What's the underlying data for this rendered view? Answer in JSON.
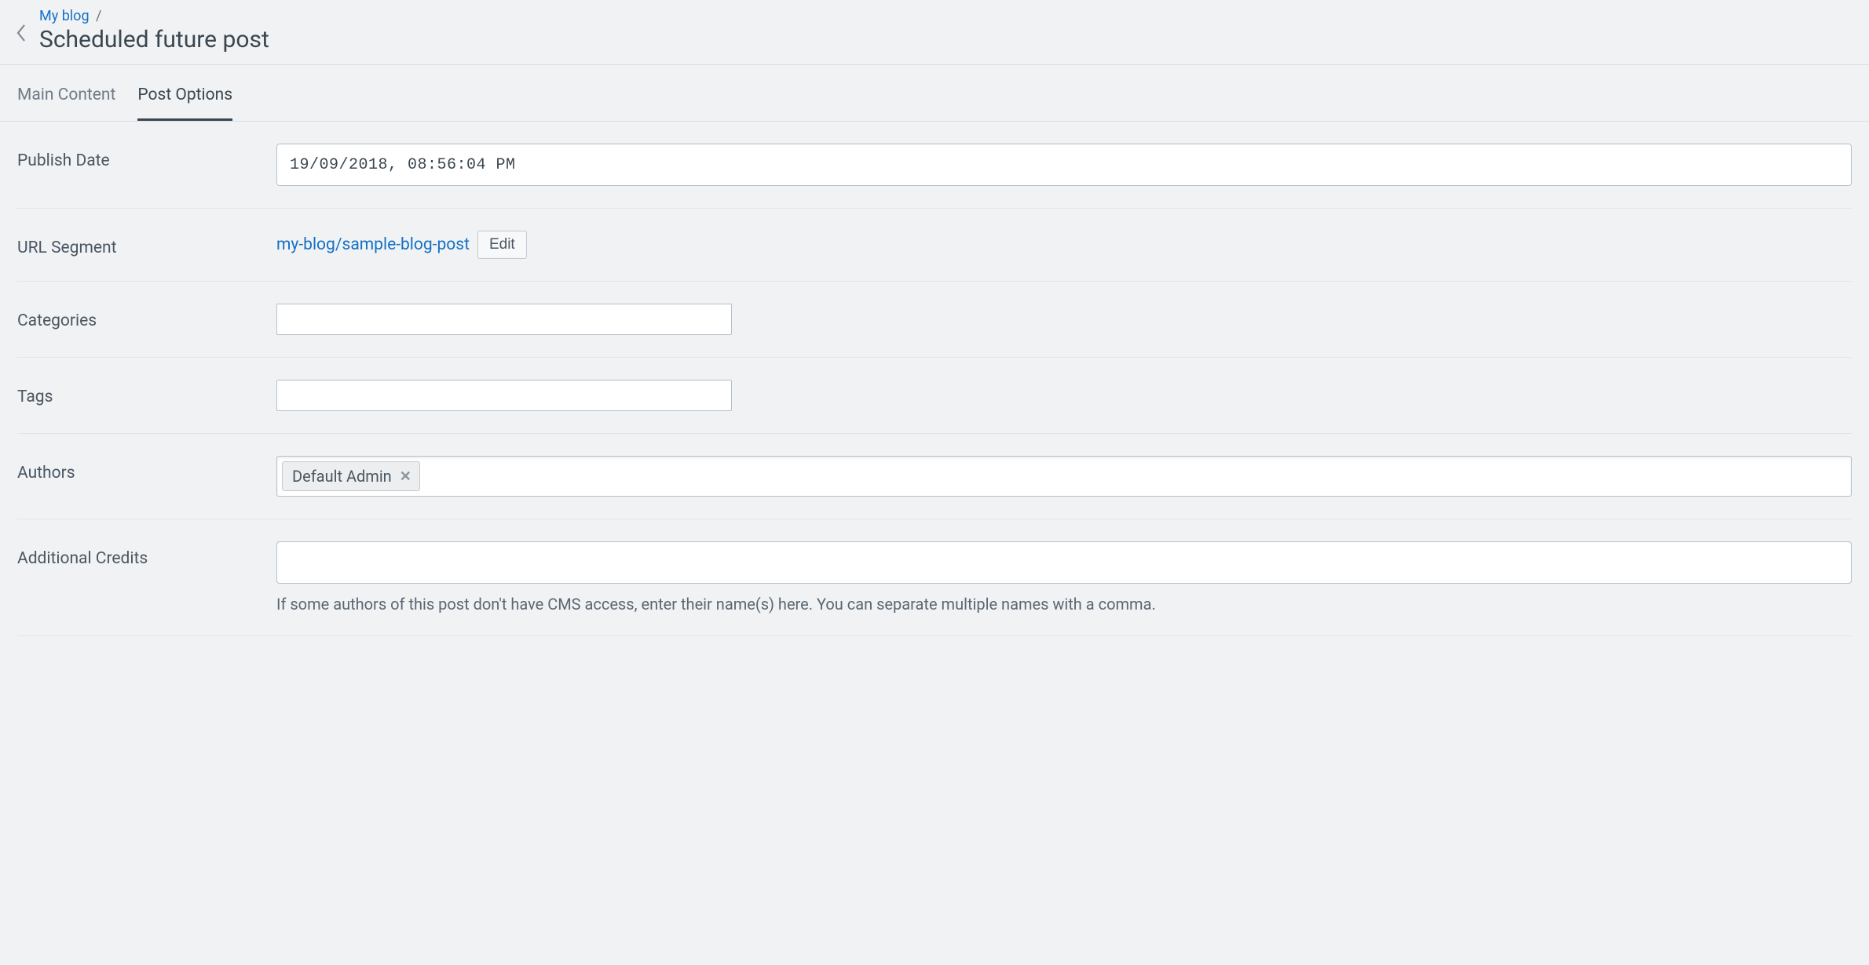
{
  "breadcrumb": {
    "parent": "My blog",
    "separator": "/",
    "title": "Scheduled future post"
  },
  "tabs": [
    {
      "label": "Main Content",
      "active": false
    },
    {
      "label": "Post Options",
      "active": true
    }
  ],
  "fields": {
    "publish_date": {
      "label": "Publish Date",
      "value": "19/09/2018, 08:56:04 PM"
    },
    "url_segment": {
      "label": "URL Segment",
      "url": "my-blog/sample-blog-post",
      "edit_label": "Edit"
    },
    "categories": {
      "label": "Categories"
    },
    "tags": {
      "label": "Tags"
    },
    "authors": {
      "label": "Authors",
      "chips": [
        "Default Admin"
      ]
    },
    "additional_credits": {
      "label": "Additional Credits",
      "help": "If some authors of this post don't have CMS access, enter their name(s) here. You can separate multiple names with a comma."
    }
  }
}
